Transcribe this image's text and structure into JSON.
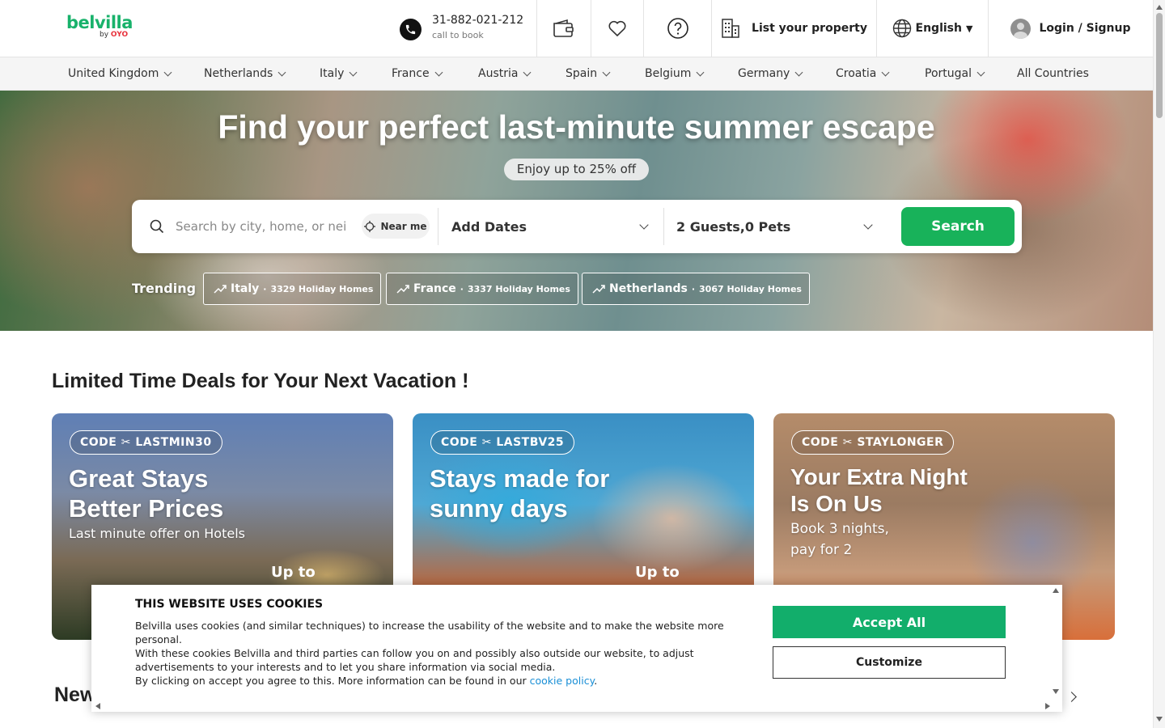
{
  "header": {
    "logo_brand": "belvilla",
    "logo_by": "by",
    "logo_oyo": "OYO",
    "phone_number": "31-882-021-212",
    "phone_sub": "call to book",
    "list_property": "List your property",
    "language": "English",
    "login": "Login / Signup"
  },
  "countries": [
    "United Kingdom",
    "Netherlands",
    "Italy",
    "France",
    "Austria",
    "Spain",
    "Belgium",
    "Germany",
    "Croatia",
    "Portugal"
  ],
  "all_countries": "All Countries",
  "hero": {
    "title": "Find your perfect last-minute summer escape",
    "pill": "Enjoy up to 25% off",
    "search_placeholder": "Search by city, home, or neighbourhood",
    "near_me": "Near me",
    "dates": "Add Dates",
    "guests": "2 Guests,0 Pets",
    "search_button": "Search",
    "trending_label": "Trending",
    "trending": [
      {
        "name": "Italy",
        "count": "3329 Holiday Homes"
      },
      {
        "name": "France",
        "count": "3337 Holiday Homes"
      },
      {
        "name": "Netherlands",
        "count": "3067 Holiday Homes"
      }
    ]
  },
  "deals": {
    "title": "Limited Time Deals for Your Next Vacation !",
    "cards": [
      {
        "code": "CODE ✂ LASTMIN30",
        "headline": "Great Stays Better Prices",
        "sub": "Last minute offer on Hotels",
        "upto": "Up to"
      },
      {
        "code": "CODE ✂ LASTBV25",
        "headline": "Stays made for sunny days",
        "sub": "",
        "upto": "Up to"
      },
      {
        "code": "CODE ✂ STAYLONGER",
        "headline": "Your Extra Night Is On Us",
        "sub": "Book 3 nights, pay for 2",
        "upto": ""
      }
    ]
  },
  "new_section_title": "New",
  "cookie": {
    "title": "THIS WEBSITE USES COOKIES",
    "p1": "Belvilla uses cookies (and similar techniques) to increase the usability of the website and to make the website more personal.",
    "p2": "With these cookies Belvilla and third parties can follow you on and possibly also outside our website, to adjust advertisements to your interests and to let you share information via social media.",
    "p3_prefix": "By clicking on accept you agree to this. More information can be found in our ",
    "p3_link": "cookie policy",
    "p3_suffix": ".",
    "accept": "Accept All",
    "customize": "Customize"
  },
  "colors": {
    "brand_green": "#18b26b",
    "search_green": "#18b25a",
    "accept_green": "#12ae6b",
    "oyo_red": "#e8313b",
    "link_blue": "#1a8fd6"
  },
  "icons": [
    "phone-icon",
    "wallet-icon",
    "heart-icon",
    "help-icon",
    "building-icon",
    "globe-icon",
    "user-avatar-icon",
    "search-icon",
    "crosshair-icon",
    "trending-up-icon"
  ]
}
